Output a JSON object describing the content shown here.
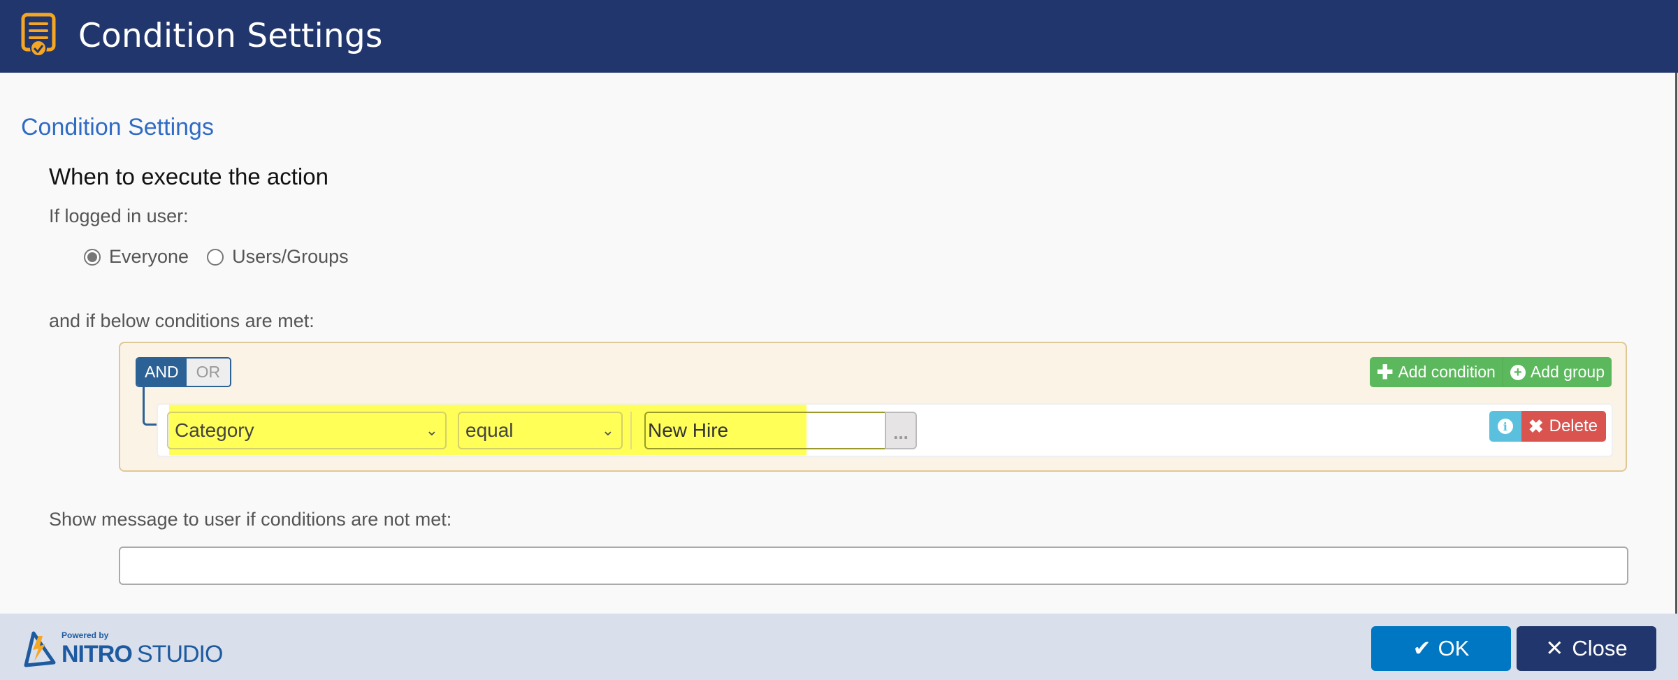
{
  "header": {
    "title": "Condition Settings",
    "icon": "checklist-badge-icon"
  },
  "section": {
    "title": "Condition Settings",
    "subheading": "When to execute the action",
    "user_label": "If logged in user:",
    "user_options": [
      {
        "label": "Everyone",
        "checked": true
      },
      {
        "label": "Users/Groups",
        "checked": false
      }
    ],
    "conditions_label": "and if below conditions are met:"
  },
  "group": {
    "and_label": "AND",
    "or_label": "OR",
    "selected_operator": "AND",
    "add_condition_label": "Add condition",
    "add_group_label": "Add group",
    "rules": [
      {
        "field": "Category",
        "operator": "equal",
        "value": "New Hire",
        "browse_label": "...",
        "delete_label": "Delete"
      }
    ]
  },
  "message": {
    "label": "Show message to user if conditions are not met:",
    "value": ""
  },
  "footer": {
    "powered_by": "Powered by",
    "brand_bold": "NITRO",
    "brand_light": "STUDIO",
    "ok_label": "OK",
    "close_label": "Close"
  },
  "colors": {
    "header_bg": "#21366d",
    "section_title": "#2f6bc4",
    "highlight": "#ffff57",
    "ok": "#0077c2",
    "close": "#21366d",
    "add": "#5cb85c",
    "delete": "#d9534f",
    "info": "#5bc0de"
  }
}
